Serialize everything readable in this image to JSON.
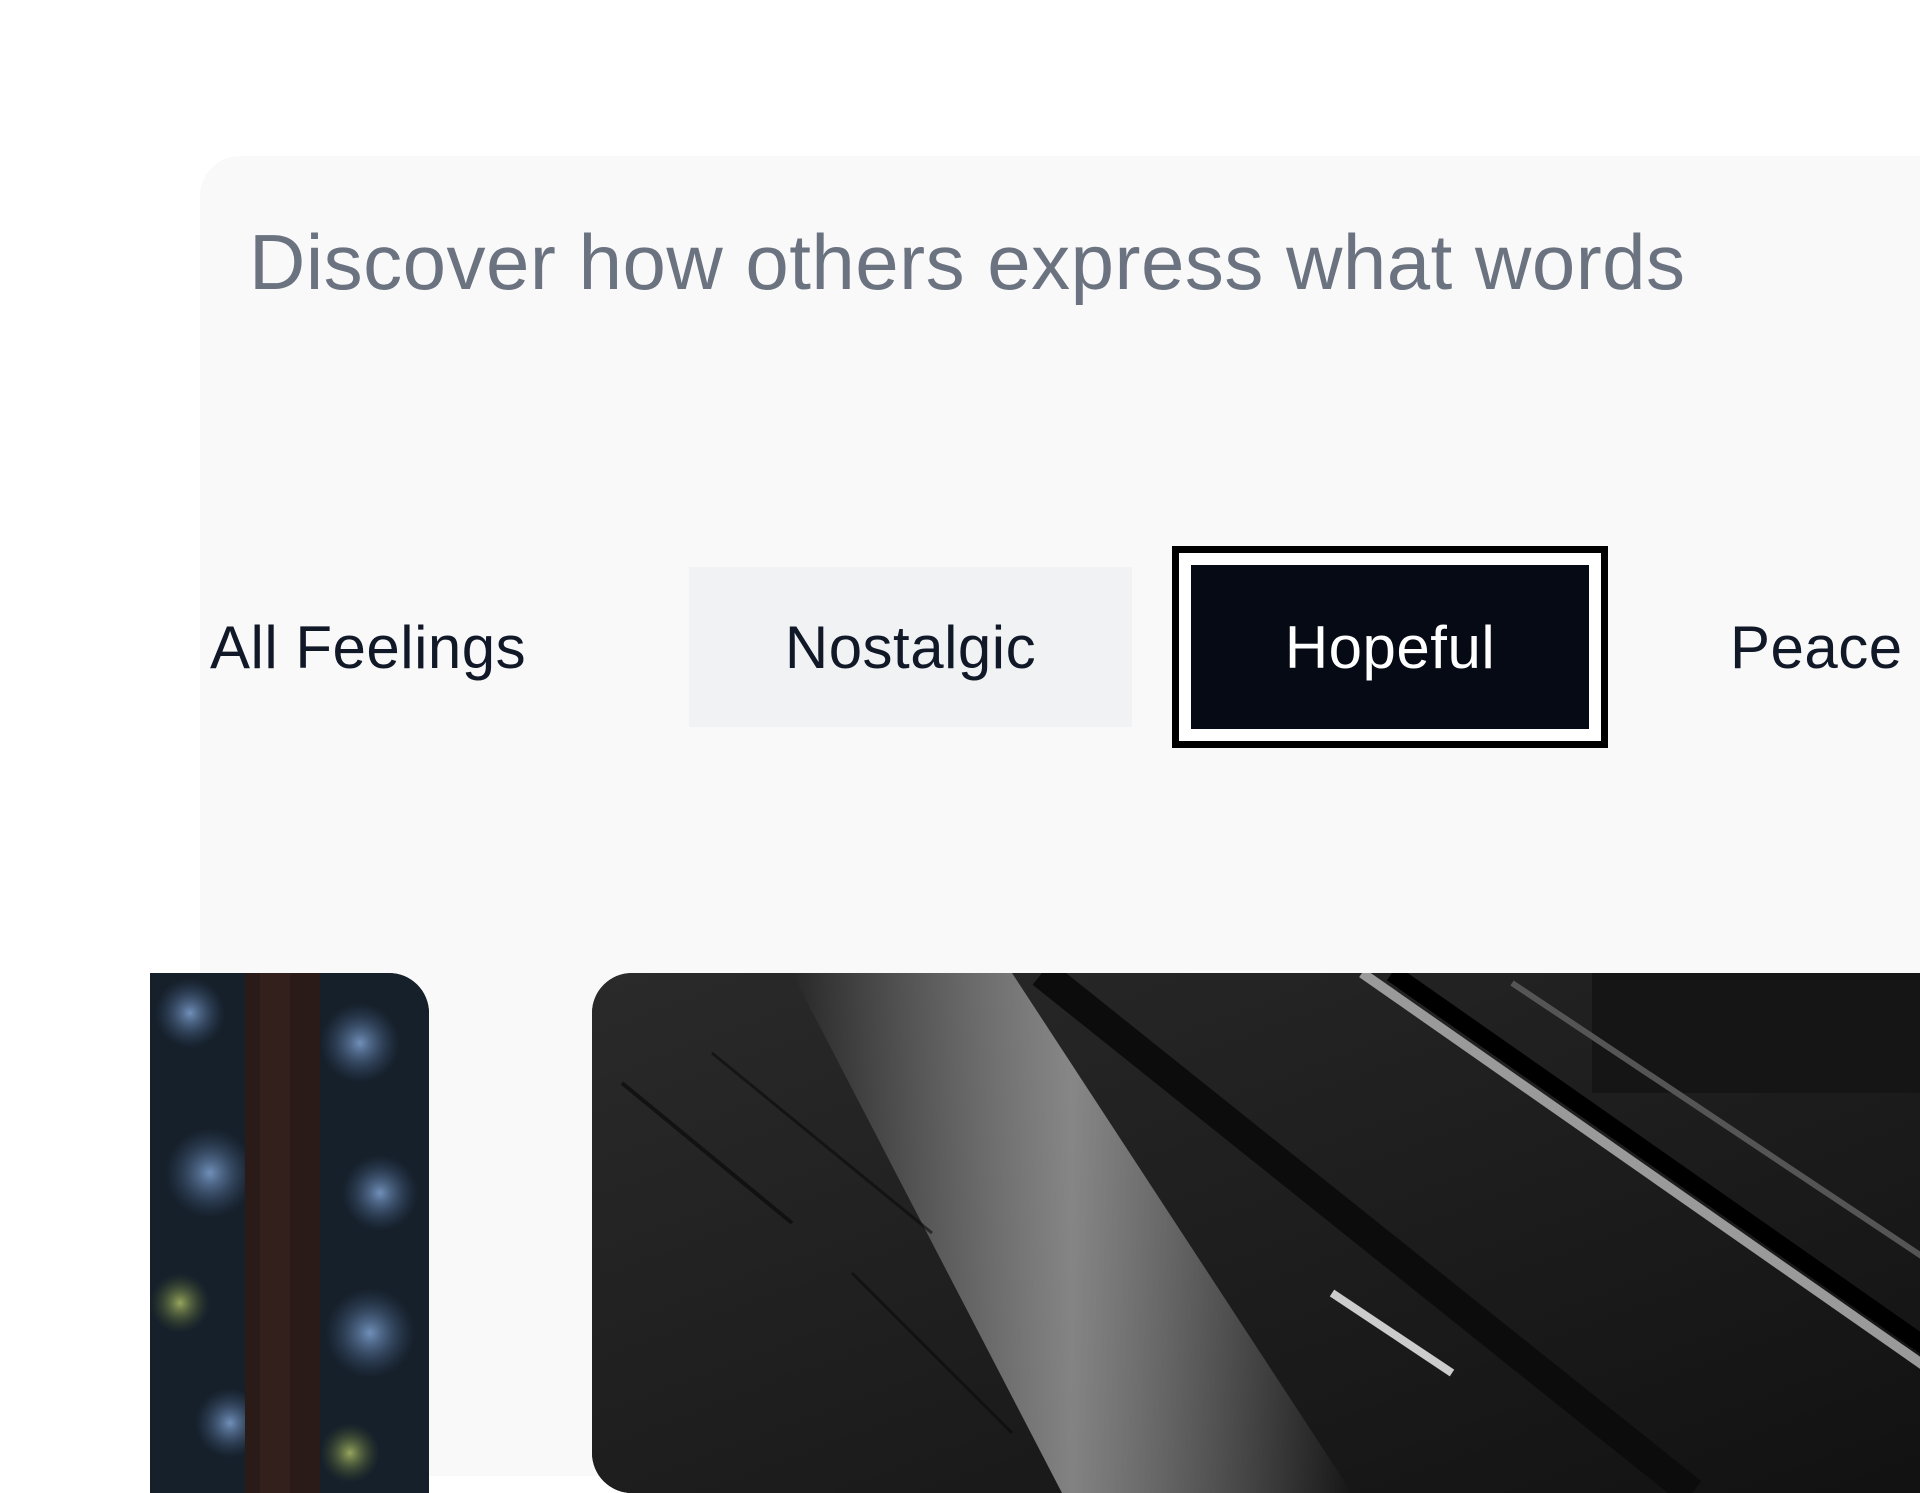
{
  "header": {
    "subtitle": "Discover how others express what words"
  },
  "filters": [
    {
      "label": "All Feelings",
      "state": "default"
    },
    {
      "label": "Nostalgic",
      "state": "hover"
    },
    {
      "label": "Hopeful",
      "state": "selected"
    },
    {
      "label": "Peace",
      "state": "default"
    }
  ],
  "gallery": {
    "cards": [
      {
        "kind": "forest-photo"
      },
      {
        "kind": "wet-street-photo"
      }
    ]
  },
  "colors": {
    "panel_bg": "#f9f9f9",
    "subtitle": "#6b7280",
    "text": "#111827",
    "selected_bg": "#050a14",
    "hover_bg": "#f1f2f4"
  }
}
